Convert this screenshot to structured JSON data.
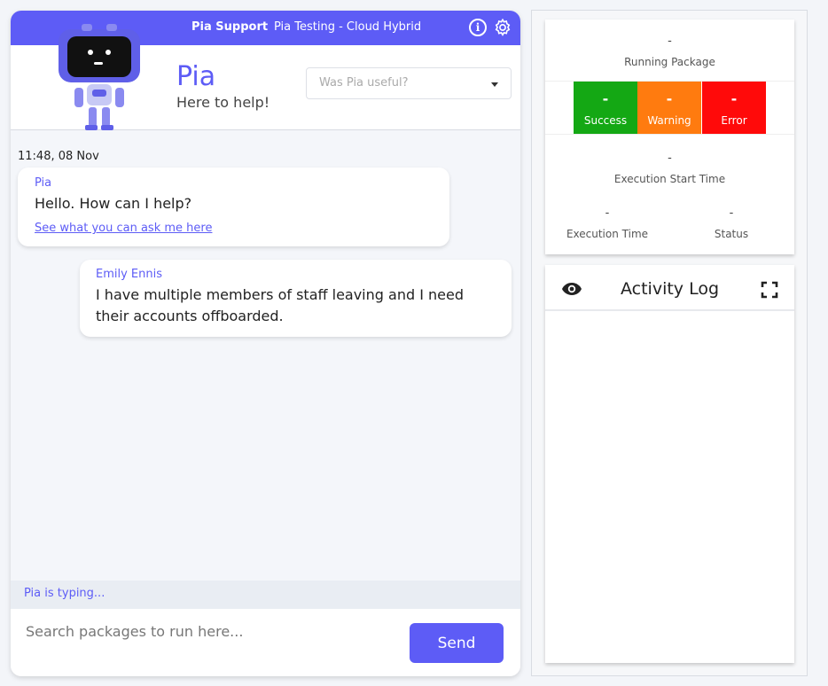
{
  "topbar": {
    "support_label": "Pia Support",
    "context_label": "Pia Testing - Cloud Hybrid",
    "info_glyph": "i"
  },
  "header": {
    "title": "Pia",
    "subtitle": "Here to help!",
    "feedback_placeholder": "Was Pia useful?"
  },
  "chat": {
    "timestamp": "11:48, 08 Nov",
    "messages": [
      {
        "sender": "Pia",
        "text": "Hello. How can I help?",
        "link": "See what you can ask me here"
      },
      {
        "sender": "Emily Ennis",
        "text": "I have multiple members of staff leaving and I need their accounts offboarded."
      }
    ],
    "typing_text": "Pia is typing...",
    "input_placeholder": "Search packages to run here...",
    "send_label": "Send"
  },
  "status": {
    "running_package_value": "-",
    "running_package_label": "Running Package",
    "tiles": [
      {
        "value": "-",
        "label": "Success",
        "color": "#14a814"
      },
      {
        "value": "-",
        "label": "Warning",
        "color": "#ff7b0f"
      },
      {
        "value": "-",
        "label": "Error",
        "color": "#ff0a0a"
      }
    ],
    "exec_start_value": "-",
    "exec_start_label": "Execution Start Time",
    "exec_time_value": "-",
    "exec_time_label": "Execution Time",
    "status_value": "-",
    "status_label": "Status"
  },
  "activity_log": {
    "title": "Activity Log"
  },
  "colors": {
    "accent": "#5d5cf6"
  }
}
